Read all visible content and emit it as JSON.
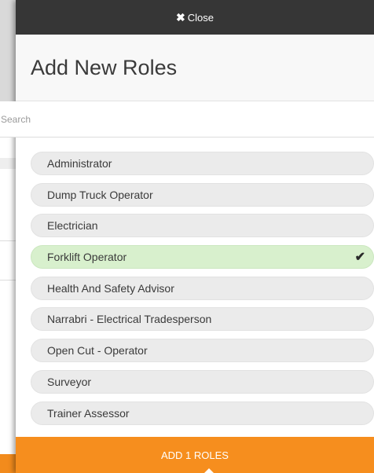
{
  "modal": {
    "close_label": "Close",
    "close_icon": "close-x-icon",
    "title": "Add New Roles"
  },
  "search": {
    "placeholder": "Search",
    "value": ""
  },
  "roles": [
    {
      "label": "Administrator",
      "selected": false
    },
    {
      "label": "Dump Truck Operator",
      "selected": false
    },
    {
      "label": "Electrician",
      "selected": false
    },
    {
      "label": "Forklift Operator",
      "selected": true
    },
    {
      "label": "Health And Safety Advisor",
      "selected": false
    },
    {
      "label": "Narrabri - Electrical Tradesperson",
      "selected": false
    },
    {
      "label": "Open Cut - Operator",
      "selected": false
    },
    {
      "label": "Surveyor",
      "selected": false
    },
    {
      "label": "Trainer Assessor",
      "selected": false
    }
  ],
  "footer": {
    "add_label": "ADD 1 ROLES"
  },
  "colors": {
    "accent": "#f68e1e",
    "selected_bg": "#d8f0cd",
    "close_bar": "#363636"
  }
}
